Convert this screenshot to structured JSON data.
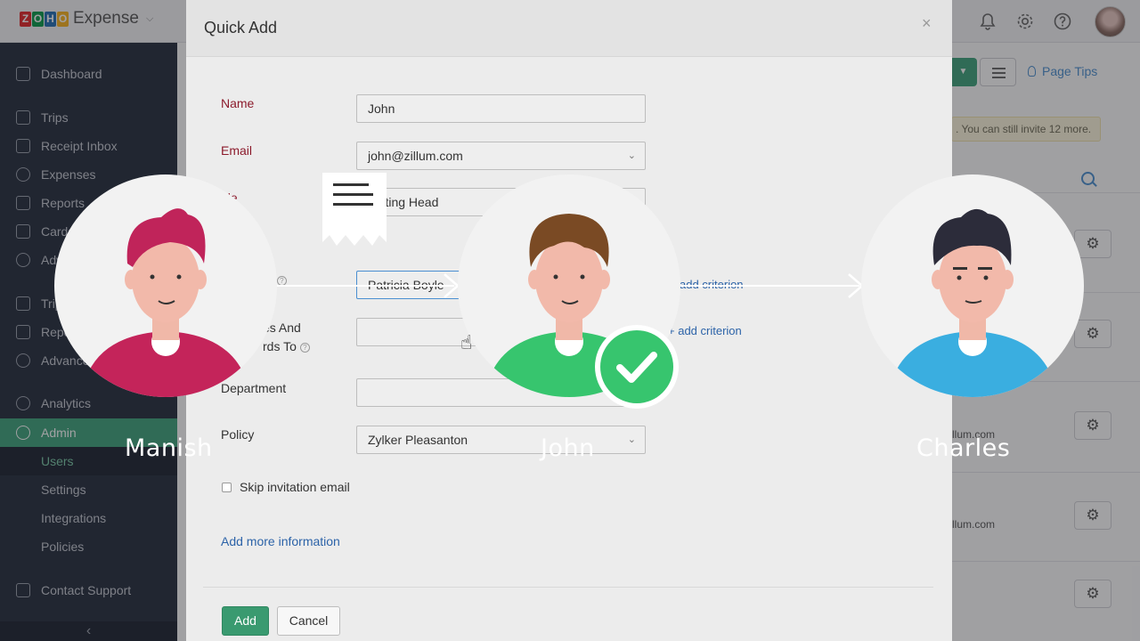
{
  "brand": {
    "zoho_letters": [
      "Z",
      "O",
      "H",
      "O"
    ],
    "zoho_colors": [
      "#e42527",
      "#089949",
      "#226db4",
      "#f9b21d"
    ],
    "product": "Expense"
  },
  "sidebar": {
    "items": [
      {
        "label": "Dashboard",
        "icon": "home-icon"
      },
      {
        "label": "Trips",
        "icon": "suitcase-icon"
      },
      {
        "label": "Receipt Inbox",
        "icon": "inbox-icon"
      },
      {
        "label": "Expenses",
        "icon": "coin-icon"
      },
      {
        "label": "Reports",
        "icon": "folder-icon"
      },
      {
        "label": "Cards",
        "icon": "card-icon"
      },
      {
        "label": "Advances",
        "icon": "cash-icon"
      },
      {
        "label": "Trips",
        "icon": "plane-icon"
      },
      {
        "label": "Reports",
        "icon": "report-icon"
      },
      {
        "label": "Advances",
        "icon": "check-icon"
      },
      {
        "label": "Analytics",
        "icon": "chart-icon"
      },
      {
        "label": "Admin",
        "icon": "admin-icon"
      }
    ],
    "admin_sub": [
      "Users",
      "Settings",
      "Integrations",
      "Policies"
    ],
    "support": "Contact Support",
    "collapse": "‹"
  },
  "background": {
    "page_tips": "Page Tips",
    "invite_banner": ". You can still invite 12 more.",
    "email_fragments": [
      "llum.com",
      "llum.com"
    ]
  },
  "modal": {
    "title": "Quick Add",
    "close": "×",
    "fields": {
      "name_label": "Name",
      "name_value": "John",
      "email_label": "Email",
      "email_value": "john@zillum.com",
      "role_label": "ole",
      "role_value": "rketing Head",
      "submits_label": "o",
      "submits_value": "Patricia Boyle",
      "approves_label_1": "es And",
      "approves_label_2": "rds To",
      "department_label": "Department",
      "policy_label": "Policy",
      "policy_value": "Zylker Pleasanton"
    },
    "add_criterion": "add criterion",
    "skip_invitation": "Skip invitation email",
    "add_more": "Add more information",
    "add_button": "Add",
    "cancel_button": "Cancel"
  },
  "workflow": {
    "people": [
      {
        "name": "Manish",
        "hair": "#c0245a",
        "shirt": "#c4245a"
      },
      {
        "name": "John",
        "hair": "#7a4a24",
        "shirt": "#37c56e"
      },
      {
        "name": "Charles",
        "hair": "#2c2c3a",
        "shirt": "#3aaee0"
      }
    ],
    "approved_marker": "check-icon"
  },
  "colors": {
    "accent": "#3da37a",
    "link": "#2c63a8",
    "required": "#8c1b2c"
  }
}
